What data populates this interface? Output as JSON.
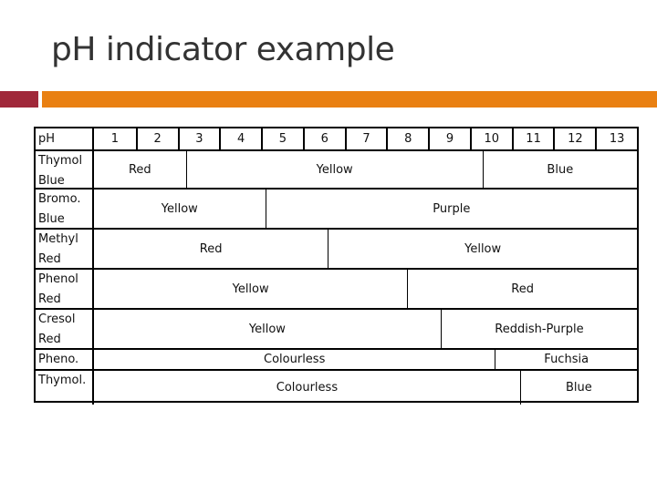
{
  "slide": {
    "title": "pH indicator example"
  },
  "table": {
    "header_label": "pH",
    "ph_values": [
      "1",
      "2",
      "3",
      "4",
      "5",
      "6",
      "7",
      "8",
      "9",
      "10",
      "11",
      "12",
      "13"
    ],
    "rows": [
      {
        "name": "Thymol Blue",
        "label_lines": [
          "Thymol",
          "Blue"
        ],
        "segments": [
          {
            "color": "Red",
            "from_ph": 0.5,
            "to_ph": 2.7
          },
          {
            "color": "Yellow",
            "from_ph": 2.7,
            "to_ph": 9.8
          },
          {
            "color": "Blue",
            "from_ph": 9.8,
            "to_ph": 13.5
          }
        ]
      },
      {
        "name": "Bromo. Blue",
        "label_lines": [
          "Bromo.",
          "Blue"
        ],
        "segments": [
          {
            "color": "Yellow",
            "from_ph": 0.5,
            "to_ph": 4.6
          },
          {
            "color": "Purple",
            "from_ph": 4.6,
            "to_ph": 13.5
          }
        ]
      },
      {
        "name": "Methyl Red",
        "label_lines": [
          "Methyl",
          "Red"
        ],
        "segments": [
          {
            "color": "Red",
            "from_ph": 0.5,
            "to_ph": 6.1
          },
          {
            "color": "Yellow",
            "from_ph": 6.1,
            "to_ph": 13.5
          }
        ]
      },
      {
        "name": "Phenol Red",
        "label_lines": [
          "Phenol",
          "Red"
        ],
        "segments": [
          {
            "color": "Yellow",
            "from_ph": 0.5,
            "to_ph": 8.0
          },
          {
            "color": "Red",
            "from_ph": 8.0,
            "to_ph": 13.5
          }
        ]
      },
      {
        "name": "Cresol Red",
        "label_lines": [
          "Cresol",
          "Red"
        ],
        "segments": [
          {
            "color": "Yellow",
            "from_ph": 0.5,
            "to_ph": 8.8
          },
          {
            "color": "Reddish-Purple",
            "from_ph": 8.8,
            "to_ph": 13.5
          }
        ]
      },
      {
        "name": "Pheno.",
        "label_lines": [
          "Pheno."
        ],
        "segments": [
          {
            "color": "Colourless",
            "from_ph": 0.5,
            "to_ph": 10.1
          },
          {
            "color": "Fuchsia",
            "from_ph": 10.1,
            "to_ph": 13.5
          }
        ]
      },
      {
        "name": "Thymol.",
        "label_lines": [
          "Thymol."
        ],
        "segments": [
          {
            "color": "Colourless",
            "from_ph": 0.5,
            "to_ph": 10.7
          },
          {
            "color": "Blue",
            "from_ph": 10.7,
            "to_ph": 13.5
          }
        ]
      }
    ]
  },
  "colors": {
    "accent_red": "#a0283a",
    "accent_orange": "#e98012"
  }
}
